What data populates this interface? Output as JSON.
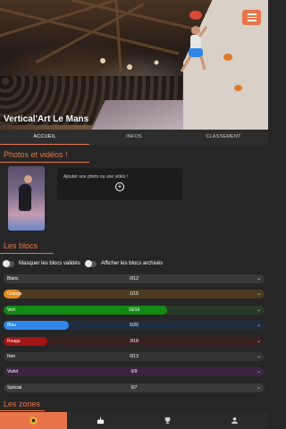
{
  "header": {
    "title": "Vertical'Art Le Mans"
  },
  "tabs": [
    {
      "label": "ACCUEIL",
      "active": true
    },
    {
      "label": "INFOS",
      "active": false
    },
    {
      "label": "CLASSEMENT",
      "active": false
    }
  ],
  "media": {
    "title": "Photos et vidéos !",
    "add_label": "Ajouter une photo ou une vidéo !"
  },
  "blocks": {
    "title": "Les blocs",
    "toggle_hide_valid": "Masquer les blocs validés",
    "toggle_show_archived": "Afficher les blocs archivés",
    "rows": [
      {
        "name": "Blanc",
        "count": "0/12",
        "progress": 0.0,
        "bg": "#3a3a3a",
        "color": "#ffffff"
      },
      {
        "name": "Orange",
        "count": "1/15",
        "progress": 0.0667,
        "bg": "#4d3b1f",
        "color": "#e38a1c"
      },
      {
        "name": "Vert",
        "count": "10/16",
        "progress": 0.625,
        "bg": "#2a3a2a",
        "color": "#138a13"
      },
      {
        "name": "Bleu",
        "count": "5/20",
        "progress": 0.25,
        "bg": "#1f2d40",
        "color": "#2f86e8"
      },
      {
        "name": "Rouge",
        "count": "3/18",
        "progress": 0.1667,
        "bg": "#3a1f1f",
        "color": "#a11414"
      },
      {
        "name": "Noir",
        "count": "0/13",
        "progress": 0.0,
        "bg": "#333333",
        "color": "#000000"
      },
      {
        "name": "Violet",
        "count": "0/9",
        "progress": 0.0,
        "bg": "#3a2440",
        "color": "#8e2aa8"
      },
      {
        "name": "Spécial",
        "count": "0/7",
        "progress": 0.0,
        "bg": "#3a3a3a",
        "color": "#888888"
      }
    ]
  },
  "zones": {
    "title": "Les zones"
  },
  "bottom_nav": [
    {
      "icon": "home-icon",
      "active": true
    },
    {
      "icon": "cake-icon",
      "active": false
    },
    {
      "icon": "trophy-icon",
      "active": false
    },
    {
      "icon": "profile-icon",
      "active": false
    }
  ],
  "colors": {
    "accent": "#e8754a",
    "background": "#262626"
  }
}
